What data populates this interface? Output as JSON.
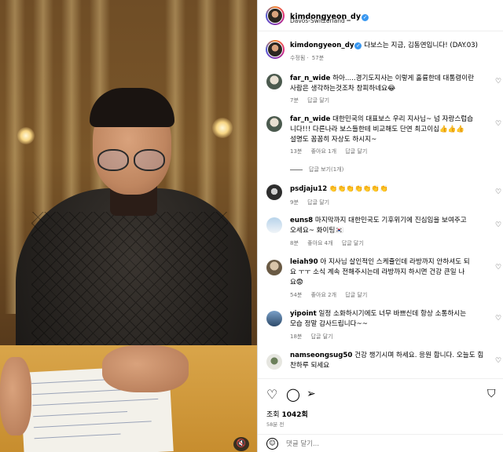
{
  "post": {
    "username": "kimdongyeon_dy",
    "location": "Davos-Switzerland",
    "caption_username": "kimdongyeon_dy",
    "caption_text": "다보스는 지금, 김동연입니다! (DAY.03)",
    "caption_meta_edited": "수정됨",
    "caption_meta_time": "57분"
  },
  "comments": [
    {
      "username": "far_n_wide",
      "lines": [
        "하아.....경기도지사는 이렇게 훌륭한데 대통령이란",
        "사람은 생각하는것조차 창피하네요😂"
      ],
      "time": "7분",
      "likes": "",
      "reply": "답글 달기"
    },
    {
      "username": "far_n_wide",
      "lines": [
        "대한민국의 대표보스 우리 지사님~ 넘 자랑스럽습",
        "니다!!! 다른나라 보스들한테 비교해도 단연 최고이십👍👍👍",
        "설명도 꼼꼼히 자상도 하시지~"
      ],
      "time": "13분",
      "likes": "좋아요 1개",
      "reply": "답글 달기",
      "view_replies": "답글 보기(1개)"
    },
    {
      "username": "psdjaju12",
      "lines": [
        "👏👏👏👏👏👏👏"
      ],
      "time": "9분",
      "likes": "",
      "reply": "답글 달기"
    },
    {
      "username": "euns8",
      "lines": [
        "마지막까지 대한민국도 기후위기에 진심임을 보여주고",
        "오세요~ 화이팅🇰🇷"
      ],
      "time": "8분",
      "likes": "좋아요 4개",
      "reply": "답글 달기"
    },
    {
      "username": "leiah90",
      "lines": [
        "아 지사님 살인적인 스케쥴인데 라방까지 안하셔도 되",
        "요 ㅜㅜ 소식 계속 전해주시는데 라방까지 하시면 건강 큰일 나",
        "요😨"
      ],
      "time": "54분",
      "likes": "좋아요 2개",
      "reply": "답글 달기"
    },
    {
      "username": "yipoint",
      "lines": [
        "일정 소화하시기에도 너무 바쁘신데 항상 소통하시는",
        "모습 정말 감사드립니다~~"
      ],
      "time": "18분",
      "likes": "",
      "reply": "답글 달기"
    },
    {
      "username": "namseongsug50",
      "lines": [
        "건강 챙기시며 하세요. 응원 합니다. 오늘도 힘",
        "찬하루 되세요"
      ],
      "time": "",
      "likes": "",
      "reply": ""
    }
  ],
  "actions": {
    "views_label": "조회",
    "views_count": "1042회",
    "posted_ago": "58분 전",
    "add_comment_placeholder": "댓글 달기..."
  },
  "icons": {
    "like": "heart-icon",
    "comment": "comment-icon",
    "share": "share-icon",
    "save": "bookmark-icon",
    "emoji": "emoji-icon",
    "mute": "speaker-muted-icon"
  },
  "colors": {
    "verified": "#3897f0",
    "meta_gray": "#737373",
    "divider": "#efefef"
  }
}
